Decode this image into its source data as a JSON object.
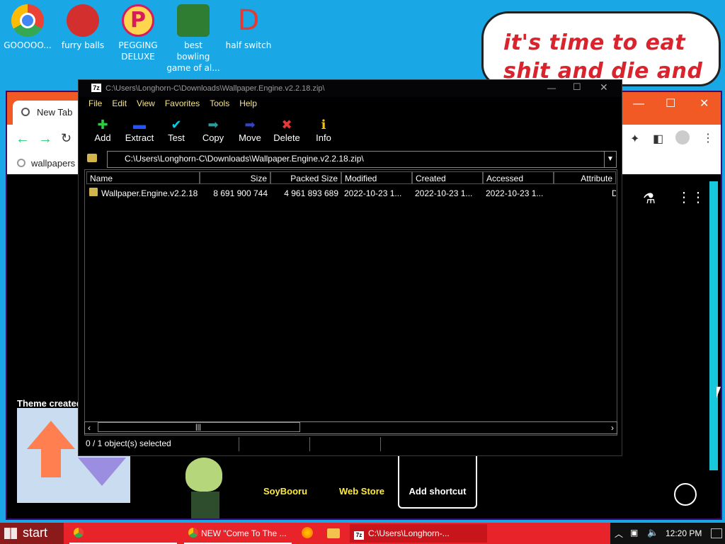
{
  "desktop": {
    "icons": [
      {
        "label": "GOOOOO...",
        "color": "#1a73e8"
      },
      {
        "label": "furry balls",
        "color": "#e53935"
      },
      {
        "label": "PEGGING DELUXE",
        "color": "#d81b60"
      },
      {
        "label": "best bowling game of al...",
        "color": "#43a047"
      },
      {
        "label": "half switch",
        "color": "#e53935"
      }
    ],
    "bubble_text": "it's time to eat shit and die and chew"
  },
  "browser": {
    "tab_label": "New Tab",
    "bookmark": "wallpapers",
    "theme_credit": "Theme created",
    "shortcuts": [
      {
        "label": "SoyBooru"
      },
      {
        "label": "Web Store"
      },
      {
        "label": "Add shortcut"
      }
    ],
    "accent": "#f15a24"
  },
  "sevenzip": {
    "title": "C:\\Users\\Longhorn-C\\Downloads\\Wallpaper.Engine.v2.2.18.zip\\",
    "menu": [
      "File",
      "Edit",
      "View",
      "Favorites",
      "Tools",
      "Help"
    ],
    "toolbar": [
      {
        "label": "Add",
        "icon": "plus-icon",
        "glyph": "✚",
        "color": "#2ecc40"
      },
      {
        "label": "Extract",
        "icon": "minus-icon",
        "glyph": "▬",
        "color": "#2255ff"
      },
      {
        "label": "Test",
        "icon": "check-icon",
        "glyph": "✔",
        "color": "#00d2e6"
      },
      {
        "label": "Copy",
        "icon": "arrow-right-icon",
        "glyph": "➡",
        "color": "#2a9d9d"
      },
      {
        "label": "Move",
        "icon": "arrow-right-icon",
        "glyph": "➡",
        "color": "#3344cc"
      },
      {
        "label": "Delete",
        "icon": "x-icon",
        "glyph": "✖",
        "color": "#e53935"
      },
      {
        "label": "Info",
        "icon": "info-icon",
        "glyph": "ℹ",
        "color": "#f1c40f"
      }
    ],
    "path": "C:\\Users\\Longhorn-C\\Downloads\\Wallpaper.Engine.v2.2.18.zip\\",
    "columns": [
      "Name",
      "Size",
      "Packed Size",
      "Modified",
      "Created",
      "Accessed",
      "Attribute"
    ],
    "rows": [
      {
        "name": "Wallpaper.Engine.v2.2.18",
        "size": "8 691 900 744",
        "packed": "4 961 893 689",
        "modified": "2022-10-23 1...",
        "created": "2022-10-23 1...",
        "accessed": "2022-10-23 1...",
        "attr": "D"
      }
    ],
    "status": "0 / 1 object(s) selected"
  },
  "taskbar": {
    "start": "start",
    "items": [
      {
        "label": "NEW \"Come To The ...",
        "icon": "chrome-icon"
      },
      {
        "label": "C:\\Users\\Longhorn-...",
        "icon": "7zip-icon"
      }
    ],
    "clock": "12:20 PM"
  }
}
